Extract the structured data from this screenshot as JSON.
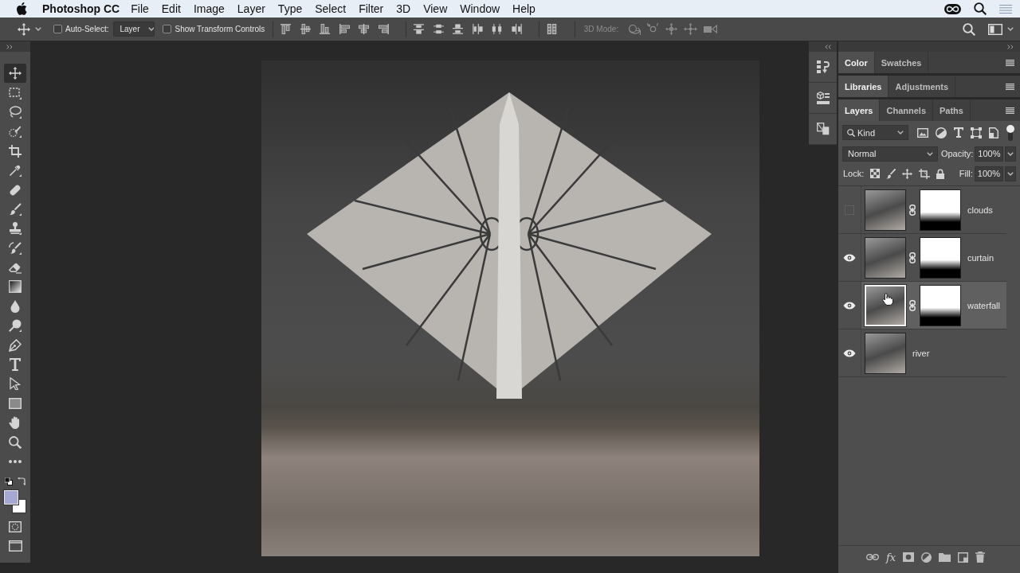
{
  "menu_bar": {
    "app_name": "Photoshop CC",
    "items": [
      "File",
      "Edit",
      "Image",
      "Layer",
      "Type",
      "Select",
      "Filter",
      "3D",
      "View",
      "Window",
      "Help"
    ]
  },
  "options_bar": {
    "auto_select": {
      "label": "Auto-Select:",
      "checked": false,
      "target": "Layer"
    },
    "transform_controls": {
      "label": "Show Transform Controls",
      "checked": false
    },
    "three_d_mode": {
      "label": "3D Mode:",
      "disabled": true
    }
  },
  "toolbar": {
    "tools": [
      {
        "kind": "move",
        "selected": true
      },
      {
        "kind": "marquee",
        "selected": false
      },
      {
        "kind": "lasso",
        "selected": false
      },
      {
        "kind": "quickselect",
        "selected": false
      },
      {
        "kind": "crop",
        "selected": false
      },
      {
        "kind": "eyedropper",
        "selected": false
      },
      {
        "kind": "healing",
        "selected": false
      },
      {
        "kind": "brush",
        "selected": false
      },
      {
        "kind": "stamp",
        "selected": false
      },
      {
        "kind": "historybrush",
        "selected": false
      },
      {
        "kind": "eraser",
        "selected": false
      },
      {
        "kind": "gradient",
        "selected": false
      },
      {
        "kind": "blur",
        "selected": false
      },
      {
        "kind": "dodge",
        "selected": false
      },
      {
        "kind": "pen",
        "selected": false
      },
      {
        "kind": "type",
        "selected": false
      },
      {
        "kind": "pathselect",
        "selected": false
      },
      {
        "kind": "rectangle",
        "selected": false
      },
      {
        "kind": "hand",
        "selected": false
      },
      {
        "kind": "zoom",
        "selected": false
      },
      {
        "kind": "more",
        "selected": false
      }
    ],
    "color_swatches": [
      {
        "kind": "foreground",
        "color": "#a4a8d2"
      },
      {
        "kind": "background",
        "color": "#ffffff"
      }
    ]
  },
  "panel_groups": [
    {
      "tabs": [
        {
          "label": "Color",
          "selected": true
        },
        {
          "label": "Swatches",
          "selected": false
        }
      ]
    },
    {
      "tabs": [
        {
          "label": "Libraries",
          "selected": true
        },
        {
          "label": "Adjustments",
          "selected": false
        }
      ]
    },
    {
      "tabs": [
        {
          "label": "Layers",
          "selected": true
        },
        {
          "label": "Channels",
          "selected": false
        },
        {
          "label": "Paths",
          "selected": false
        }
      ]
    }
  ],
  "layers_panel": {
    "filter": "Kind",
    "filter_on": true,
    "blend_mode": "Normal",
    "opacity_label": "Opacity:",
    "opacity": "100%",
    "lock_label": "Lock:",
    "fill_label": "Fill:",
    "fill": "100%",
    "layers": [
      {
        "name": "clouds",
        "visible": false,
        "selected": false,
        "has_mask": true
      },
      {
        "name": "curtain",
        "visible": true,
        "selected": false,
        "has_mask": true
      },
      {
        "name": "waterfall",
        "visible": true,
        "selected": true,
        "has_mask": true
      },
      {
        "name": "river",
        "visible": true,
        "selected": false,
        "has_mask": false
      }
    ],
    "effects_label": "fx"
  }
}
